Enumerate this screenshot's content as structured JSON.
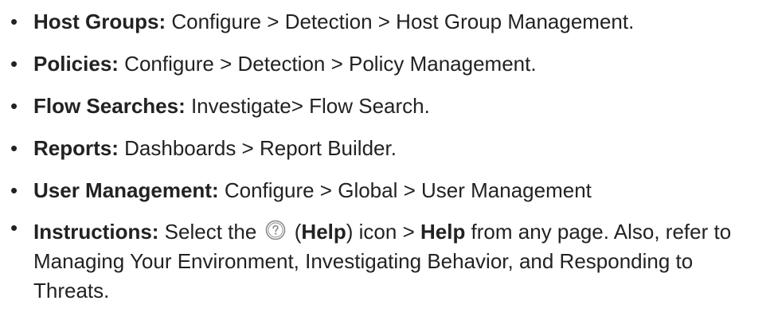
{
  "items": [
    {
      "term": "Host Groups:",
      "text": " Configure > Detection > Host Group Management."
    },
    {
      "term": "Policies:",
      "text": " Configure > Detection > Policy Management."
    },
    {
      "term": "Flow Searches:",
      "text": " Investigate> Flow Search."
    },
    {
      "term": "Reports:",
      "text": " Dashboards > Report Builder."
    },
    {
      "term": "User Management:",
      "text": " Configure > Global > User Management"
    }
  ],
  "instructions": {
    "term": "Instructions:",
    "pre_icon": " Select the ",
    "icon": "help-circle-icon",
    "paren_open": " (",
    "help_label": "Help",
    "post_icon": ") icon > ",
    "help_menu": "Help",
    "tail": " from any page. Also, refer to Managing Your Environment, Investigating Behavior, and Responding to Threats."
  },
  "bullet": "•",
  "colors": {
    "text": "#222222",
    "icon_stroke": "#8a8a8a"
  }
}
